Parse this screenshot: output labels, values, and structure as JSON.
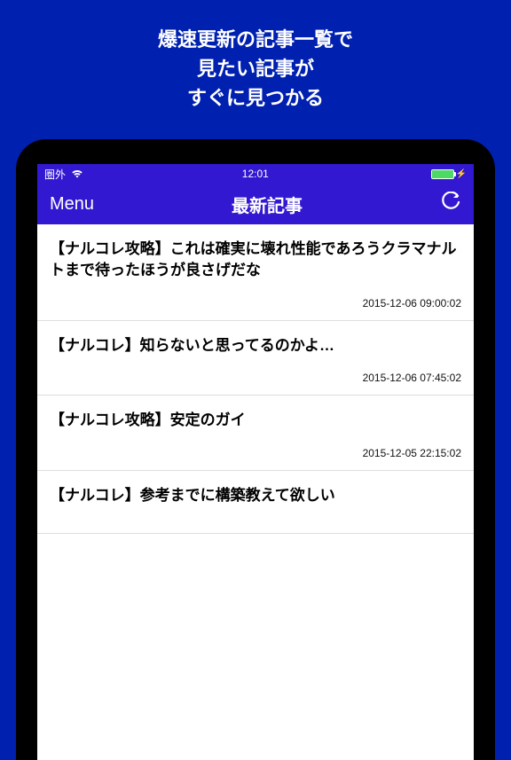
{
  "promo": {
    "line1": "爆速更新の記事一覧で",
    "line2": "見たい記事が",
    "line3": "すぐに見つかる"
  },
  "status_bar": {
    "carrier": "圏外",
    "time": "12:01"
  },
  "nav": {
    "menu_label": "Menu",
    "title": "最新記事"
  },
  "articles": [
    {
      "title": "【ナルコレ攻略】これは確実に壊れ性能であろうクラマナルトまで待ったほうが良さげだな",
      "timestamp": "2015-12-06 09:00:02"
    },
    {
      "title": "【ナルコレ】知らないと思ってるのかよ…",
      "timestamp": "2015-12-06 07:45:02"
    },
    {
      "title": "【ナルコレ攻略】安定のガイ",
      "timestamp": "2015-12-05 22:15:02"
    },
    {
      "title": "【ナルコレ】参考までに構築教えて欲しい",
      "timestamp": ""
    }
  ]
}
